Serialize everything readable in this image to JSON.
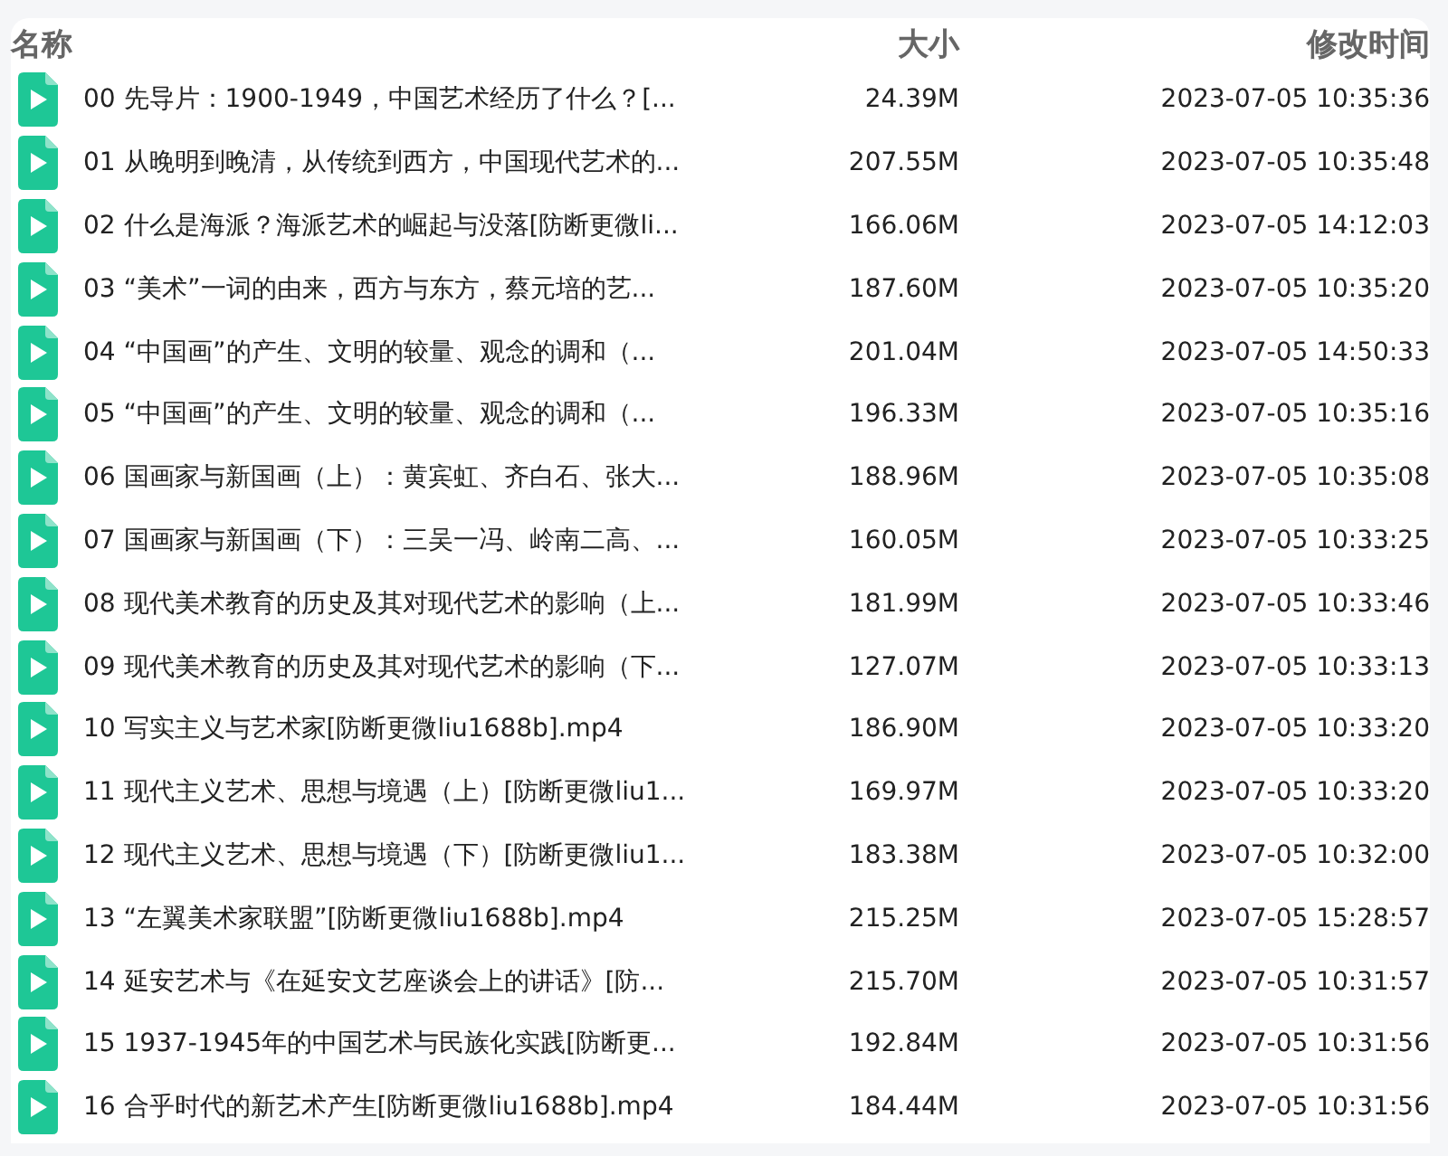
{
  "columns": {
    "name": "名称",
    "size": "大小",
    "modified": "修改时间"
  },
  "files": [
    {
      "name": "00 先导片：1900-1949，中国艺术经历了什么？[...",
      "size": "24.39M",
      "modified": "2023-07-05 10:35:36"
    },
    {
      "name": "01 从晚明到晚清，从传统到西方，中国现代艺术的...",
      "size": "207.55M",
      "modified": "2023-07-05 10:35:48"
    },
    {
      "name": "02 什么是海派？海派艺术的崛起与没落[防断更微li...",
      "size": "166.06M",
      "modified": "2023-07-05 14:12:03"
    },
    {
      "name": "03 “美术”一词的由来，西方与东方，蔡元培的艺...",
      "size": "187.60M",
      "modified": "2023-07-05 10:35:20"
    },
    {
      "name": "04 “中国画”的产生、文明的较量、观念的调和（...",
      "size": "201.04M",
      "modified": "2023-07-05 14:50:33"
    },
    {
      "name": "05 “中国画”的产生、文明的较量、观念的调和（...",
      "size": "196.33M",
      "modified": "2023-07-05 10:35:16"
    },
    {
      "name": "06 国画家与新国画（上）：黄宾虹、齐白石、张大...",
      "size": "188.96M",
      "modified": "2023-07-05 10:35:08"
    },
    {
      "name": "07 国画家与新国画（下）：三吴一冯、岭南二高、...",
      "size": "160.05M",
      "modified": "2023-07-05 10:33:25"
    },
    {
      "name": "08 现代美术教育的历史及其对现代艺术的影响（上...",
      "size": "181.99M",
      "modified": "2023-07-05 10:33:46"
    },
    {
      "name": "09 现代美术教育的历史及其对现代艺术的影响（下...",
      "size": "127.07M",
      "modified": "2023-07-05 10:33:13"
    },
    {
      "name": "10 写实主义与艺术家[防断更微liu1688b].mp4",
      "size": "186.90M",
      "modified": "2023-07-05 10:33:20"
    },
    {
      "name": "11 现代主义艺术、思想与境遇（上）[防断更微liu1...",
      "size": "169.97M",
      "modified": "2023-07-05 10:33:20"
    },
    {
      "name": "12 现代主义艺术、思想与境遇（下）[防断更微liu1...",
      "size": "183.38M",
      "modified": "2023-07-05 10:32:00"
    },
    {
      "name": "13 “左翼美术家联盟”[防断更微liu1688b].mp4",
      "size": "215.25M",
      "modified": "2023-07-05 15:28:57"
    },
    {
      "name": "14 延安艺术与《在延安文艺座谈会上的讲话》[防...",
      "size": "215.70M",
      "modified": "2023-07-05 10:31:57"
    },
    {
      "name": "15 1937-1945年的中国艺术与民族化实践[防断更...",
      "size": "192.84M",
      "modified": "2023-07-05 10:31:56"
    },
    {
      "name": "16 合乎时代的新艺术产生[防断更微liu1688b].mp4",
      "size": "184.44M",
      "modified": "2023-07-05 10:31:56"
    }
  ]
}
